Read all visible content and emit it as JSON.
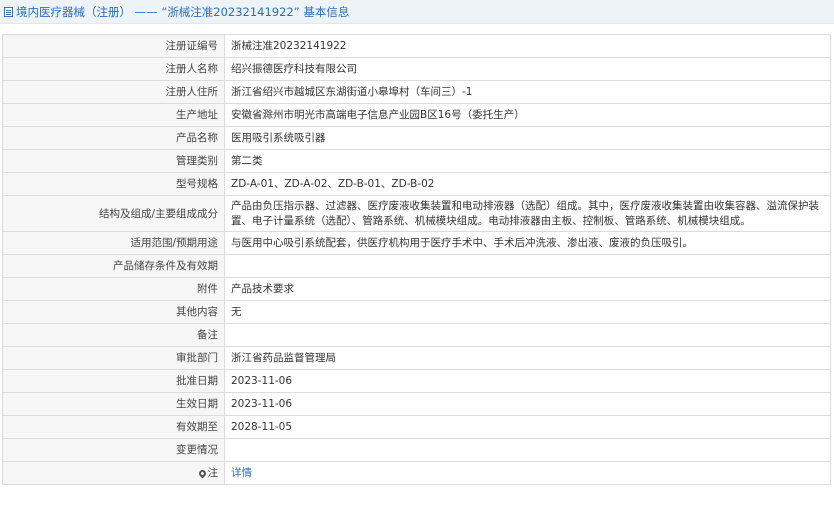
{
  "header": {
    "icon": "document-icon",
    "title": "境内医疗器械（注册） —— “浙械注准20232141922” 基本信息"
  },
  "rows": [
    {
      "label": "注册证编号",
      "value": "浙械注准20232141922"
    },
    {
      "label": "注册人名称",
      "value": "绍兴振德医疗科技有限公司"
    },
    {
      "label": "注册人住所",
      "value": "浙江省绍兴市越城区东湖街道小皋埠村（车间三）-1"
    },
    {
      "label": "生产地址",
      "value": "安徽省滁州市明光市高端电子信息产业园B区16号（委托生产）"
    },
    {
      "label": "产品名称",
      "value": "医用吸引系统吸引器"
    },
    {
      "label": "管理类别",
      "value": "第二类"
    },
    {
      "label": "型号规格",
      "value": "ZD-A-01、ZD-A-02、ZD-B-01、ZD-B-02"
    },
    {
      "label": "结构及组成/主要组成成分",
      "value": "产品由负压指示器、过滤器、医疗废液收集装置和电动排液器（选配）组成。其中，医疗废液收集装置由收集容器、溢流保护装置、电子计量系统（选配）、管路系统、机械模块组成。电动排液器由主板、控制板、管路系统、机械模块组成。"
    },
    {
      "label": "适用范围/预期用途",
      "value": "与医用中心吸引系统配套，供医疗机构用于医疗手术中、手术后冲洗液、渗出液、废液的负压吸引。"
    },
    {
      "label": "产品储存条件及有效期",
      "value": ""
    },
    {
      "label": "附件",
      "value": "产品技术要求"
    },
    {
      "label": "其他内容",
      "value": "无"
    },
    {
      "label": "备注",
      "value": ""
    },
    {
      "label": "审批部门",
      "value": "浙江省药品监督管理局"
    },
    {
      "label": "批准日期",
      "value": "2023-11-06"
    },
    {
      "label": "生效日期",
      "value": "2023-11-06"
    },
    {
      "label": "有效期至",
      "value": "2028-11-05"
    },
    {
      "label": "变更情况",
      "value": ""
    }
  ],
  "footer_row": {
    "icon": "pin-icon",
    "label": "注",
    "link_text": "详情"
  }
}
